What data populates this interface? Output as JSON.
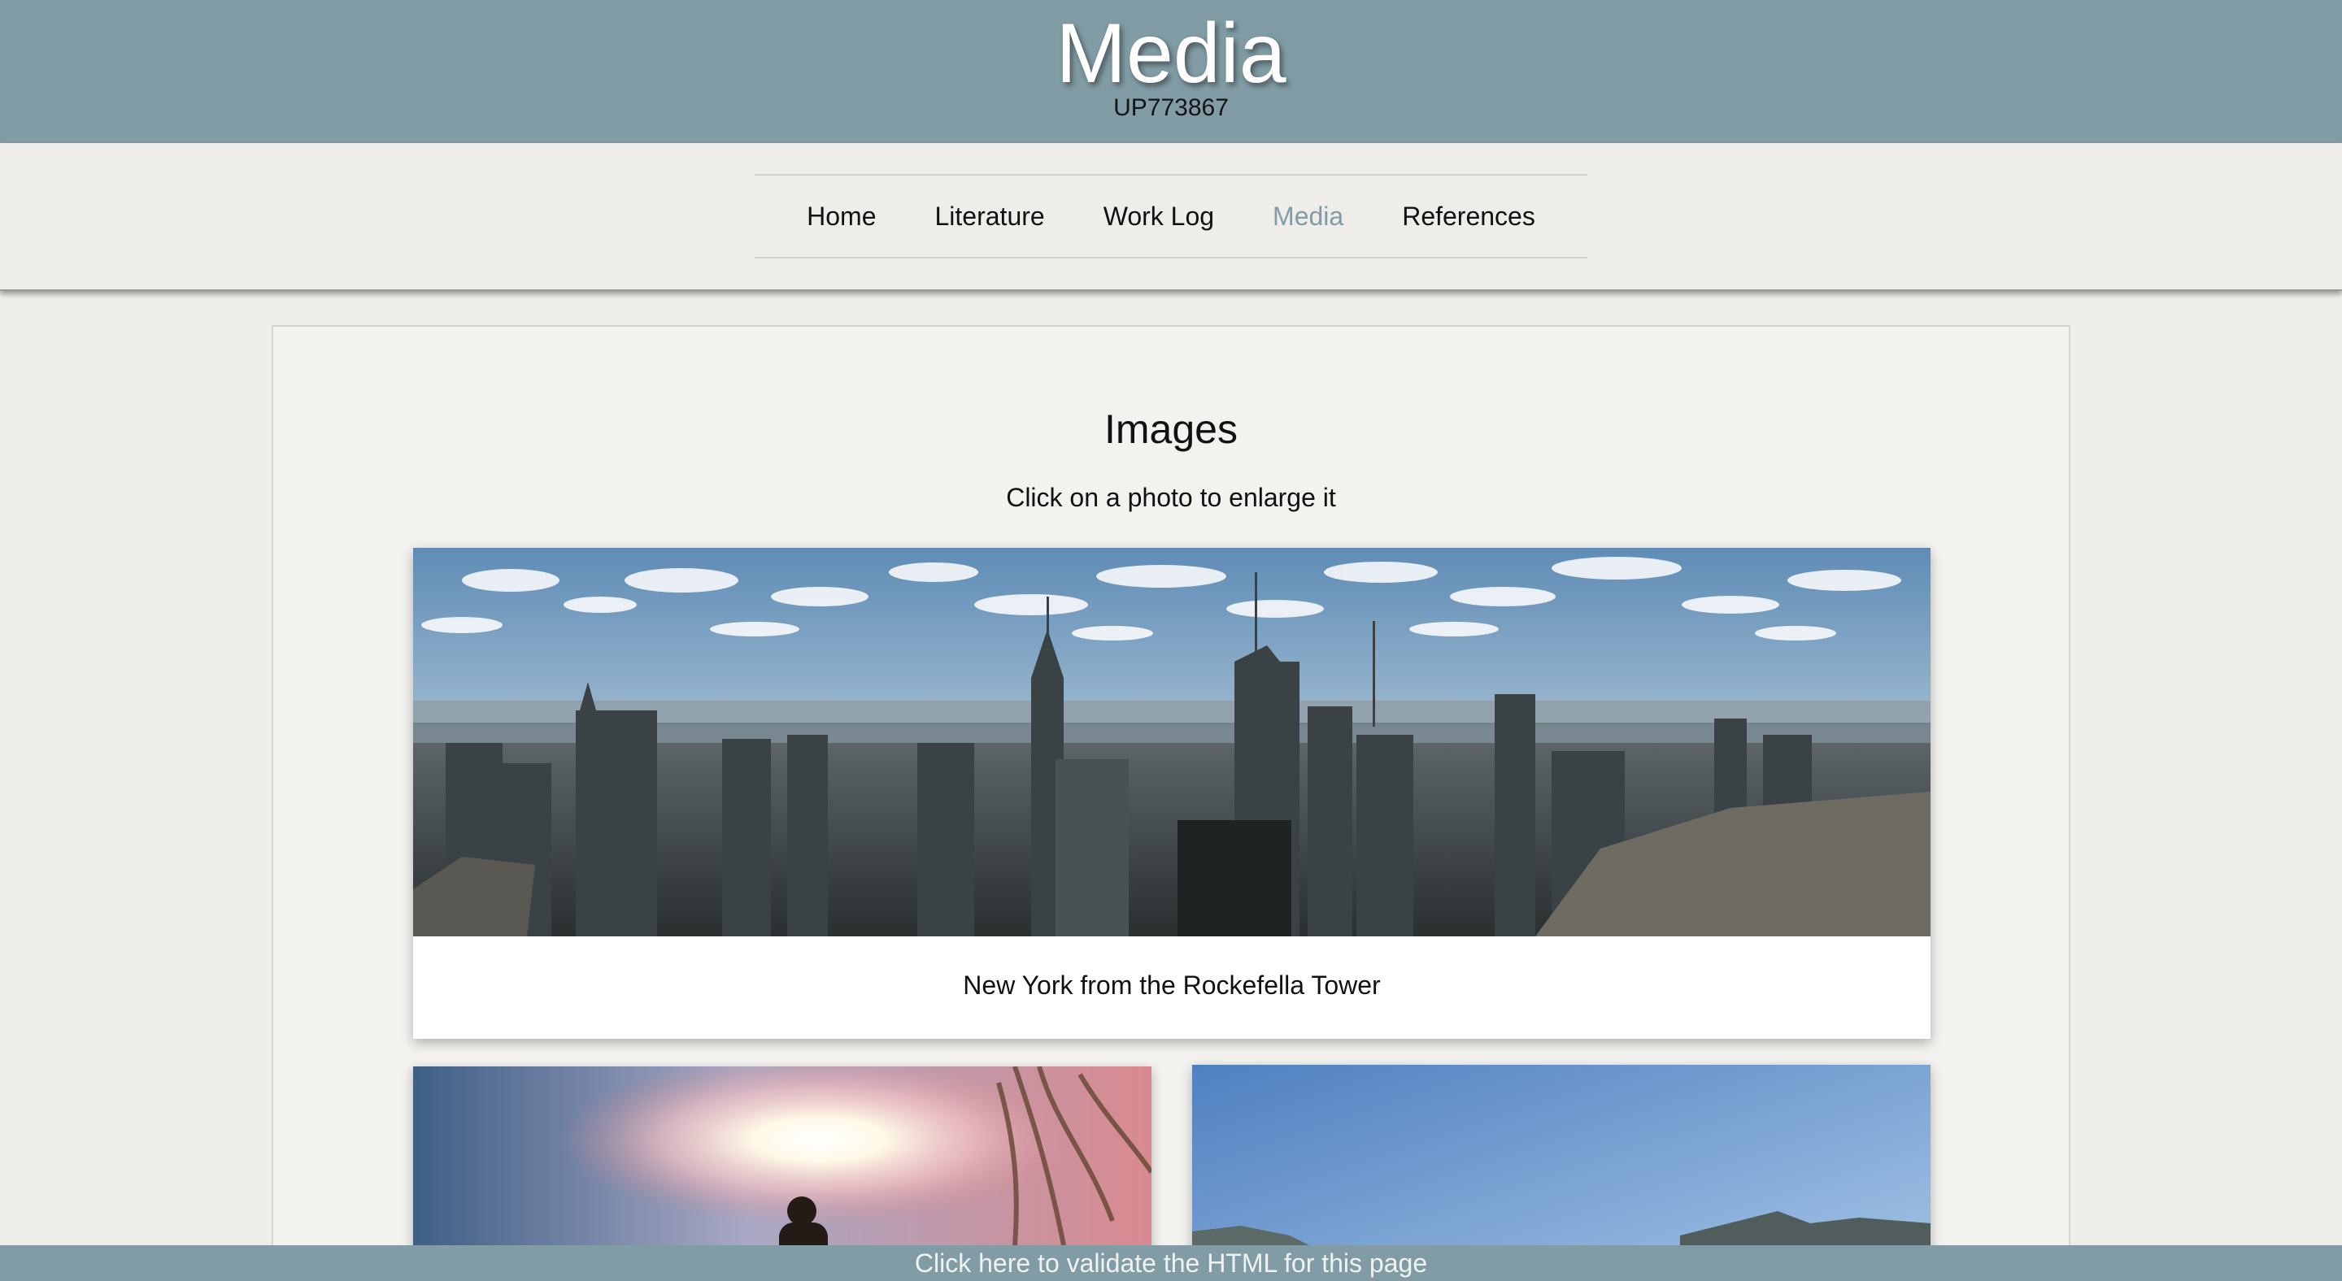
{
  "header": {
    "title": "Media",
    "subtitle": "UP773867"
  },
  "nav": {
    "items": [
      {
        "label": "Home",
        "active": false
      },
      {
        "label": "Literature",
        "active": false
      },
      {
        "label": "Work Log",
        "active": false
      },
      {
        "label": "Media",
        "active": true
      },
      {
        "label": "References",
        "active": false
      }
    ]
  },
  "main": {
    "heading": "Images",
    "hint": "Click on a photo to enlarge it",
    "photos": [
      {
        "caption": "New York from the Rockefella Tower"
      },
      {
        "caption": ""
      },
      {
        "caption": ""
      }
    ]
  },
  "footer": {
    "link_label": "Click here to validate the HTML for this page"
  },
  "colors": {
    "accent": "#819ca4",
    "background": "#efede9",
    "panel": "#f3f2ef"
  }
}
